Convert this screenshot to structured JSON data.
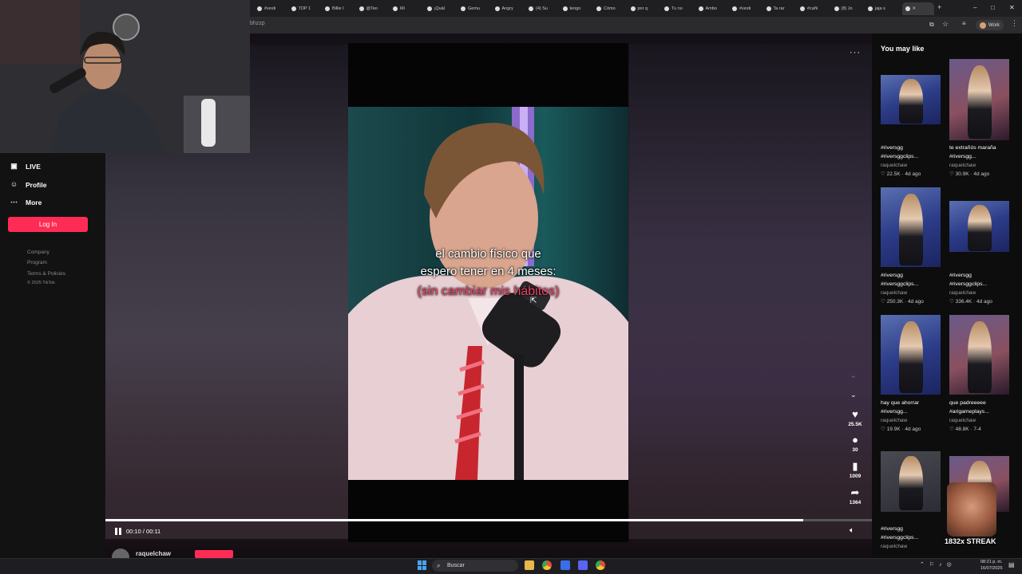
{
  "browser": {
    "tabs": [
      "#vesti",
      "TOP 1",
      "Billie I",
      "@Teo",
      "Mi",
      "¡Quál",
      "Gemu",
      "Angry",
      "(4) Su",
      "tengo",
      "Cómo",
      "por q",
      "Tu no",
      "Ambo",
      "#vesti",
      "Ta rar",
      "#cañi",
      "(8) Jo",
      "jaja s"
    ],
    "address": "bhzzp",
    "profile_label": "Work",
    "controls": {
      "minimize": "–",
      "maximize": "□",
      "close": "✕"
    },
    "new_tab": "+"
  },
  "sidebar": {
    "items": [
      {
        "label": "LIVE",
        "icon": "live-icon"
      },
      {
        "label": "Profile",
        "icon": "profile-icon"
      },
      {
        "label": "More",
        "icon": "more-icon"
      }
    ],
    "login_label": "Log In",
    "footer": [
      "Company",
      "Program",
      "Terms & Policies",
      "© 2025 TikTok"
    ]
  },
  "video": {
    "caption_line1": "el cambio físico que",
    "caption_line2": "espero tener en 4 meses:",
    "caption_line3": "(sin cambiar mis hábitos)",
    "time": "00:10 / 00:11",
    "progress": 0.91,
    "username": "raquelchaw",
    "more_menu": "···"
  },
  "actions": {
    "likes": "25.5K",
    "comments": "30",
    "saves": "1009",
    "shares": "1364"
  },
  "recommendations": {
    "title": "You may like",
    "cards": [
      {
        "line1": "#riversgg",
        "line2": "#riversggclips...",
        "author": "raquelchaw",
        "stats": "♡ 22.5K · 4d ago"
      },
      {
        "line1": "te extrañós maraña",
        "line2": "#riversgg...",
        "author": "raquelchaw",
        "stats": "♡ 30.9K · 4d ago"
      },
      {
        "line1": "#riversgg",
        "line2": "#riversggclips...",
        "author": "raquelchaw",
        "stats": "♡ 250.3K · 4d ago"
      },
      {
        "line1": "#riversgg",
        "line2": "#riversggclips...",
        "author": "raquelchaw",
        "stats": "♡ 336.4K · 4d ago"
      },
      {
        "line1": "hay que ahorrar",
        "line2": "#riversgg...",
        "author": "raquelchaw",
        "stats": "♡ 19.9K · 4d ago"
      },
      {
        "line1": "que padreeeee",
        "line2": "#arigameplays...",
        "author": "raquelchaw",
        "stats": "♡ 48.8K · 7-4"
      },
      {
        "line1": "#riversgg",
        "line2": "#riversggclips...",
        "author": "raquelchaw",
        "stats": ""
      },
      {
        "line1": "",
        "line2": "",
        "author": "",
        "stats": ""
      }
    ]
  },
  "overlay": {
    "streak": "1832x STREAK"
  },
  "taskbar": {
    "search_label": "Buscar",
    "time": "08:21 p. m.",
    "date": "16/07/2025"
  },
  "colors": {
    "accent": "#fe2c55",
    "caption_pink": "#e8426a"
  }
}
